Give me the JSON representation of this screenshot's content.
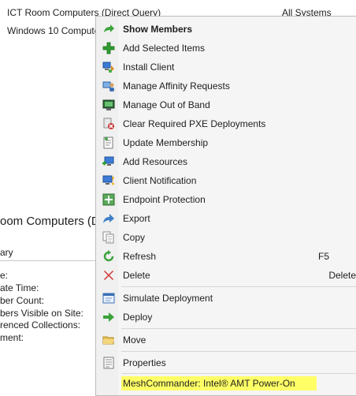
{
  "background": {
    "list_rows": [
      {
        "name": "ICT Room Computers (Direct Query)",
        "limiting": "All Systems"
      },
      {
        "name": "Windows 10 Compute"
      }
    ],
    "detail_title": "oom Computers (Di",
    "detail_tab": "ary",
    "detail_labels": [
      "e:",
      "ate Time:",
      "ber Count:",
      "bers Visible on Site:",
      "renced Collections:",
      "ment:"
    ]
  },
  "context_menu": {
    "items": [
      {
        "label": "Show Members",
        "icon": "green-arrow-icon"
      },
      {
        "label": "Add Selected Items",
        "icon": "green-plus-icon"
      },
      {
        "label": "Install Client",
        "icon": "install-client-icon"
      },
      {
        "label": "Manage Affinity Requests",
        "icon": "affinity-icon"
      },
      {
        "label": "Manage Out of Band",
        "icon": "out-of-band-icon"
      },
      {
        "label": "Clear Required PXE Deployments",
        "icon": "pxe-icon"
      },
      {
        "label": "Update Membership",
        "icon": "update-membership-icon"
      },
      {
        "label": "Add Resources",
        "icon": "add-resources-icon"
      },
      {
        "label": "Client Notification",
        "icon": "client-notification-icon"
      },
      {
        "label": "Endpoint Protection",
        "icon": "endpoint-protection-icon"
      },
      {
        "label": "Export",
        "icon": "export-arrow-icon"
      },
      {
        "label": "Copy",
        "icon": "copy-icon"
      },
      {
        "label": "Refresh",
        "icon": "refresh-icon",
        "shortcut": "F5"
      },
      {
        "label": "Delete",
        "icon": "delete-x-icon",
        "shortcut": "Delete"
      },
      {
        "label": "Simulate Deployment",
        "icon": "simulate-deployment-icon"
      },
      {
        "label": "Deploy",
        "icon": "deploy-arrow-icon"
      },
      {
        "label": "Move",
        "icon": "folder-icon"
      },
      {
        "label": "Properties",
        "icon": "properties-icon"
      },
      {
        "label": "MeshCommander: Intel® AMT Power-On",
        "icon": "",
        "highlight_color": "#ffff66"
      }
    ]
  }
}
